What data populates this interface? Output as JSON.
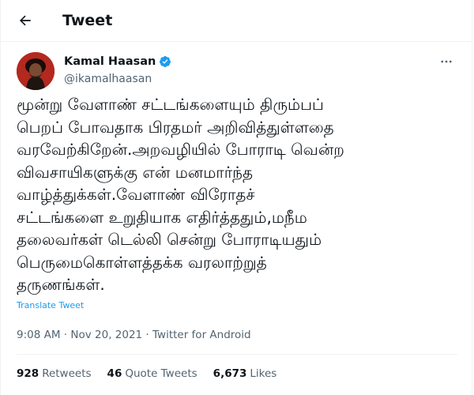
{
  "header": {
    "back_icon": "arrow-left-icon",
    "title": "Tweet"
  },
  "author": {
    "display_name": "Kamal Haasan",
    "verified_icon": "verified-badge-icon",
    "verified_color": "#1d9bf0",
    "handle": "@ikamalhaasan",
    "more_icon": "more-horizontal-icon"
  },
  "tweet": {
    "lines": [
      "மூன்று வேளாண் சட்டங்களையும் திரும்பப்",
      "பெறப் போவதாக பிரதமர் அறிவித்துள்ளதை",
      "வரவேற்கிறேன்.அறவழியில் போராடி வென்ற",
      "விவசாயிகளுக்கு என் மனமார்ந்த",
      "வாழ்த்துக்கள்.வேளாண் விரோதச்",
      "சட்டங்களை உறுதியாக எதிர்த்ததும்,மநீம",
      "தலைவர்கள் டெல்லி சென்று போராடியதும்",
      "பெருமைகொள்ளத்தக்க வரலாற்றுத்",
      "தருணங்கள்."
    ],
    "translate_label": "Translate Tweet",
    "link_color": "#1d9bf0"
  },
  "meta": {
    "time": "9:08 AM",
    "separator1": " · ",
    "date": "Nov 20, 2021",
    "separator2": " · ",
    "source": "Twitter for Android"
  },
  "stats": {
    "retweets_count": "928",
    "retweets_label": "Retweets",
    "quote_count": "46",
    "quote_label": "Quote Tweets",
    "likes_count": "6,673",
    "likes_label": "Likes"
  }
}
